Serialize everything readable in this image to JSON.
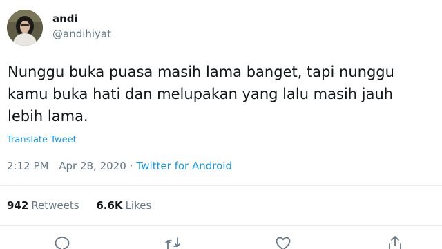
{
  "author": {
    "name": "andi",
    "handle": "@andihiyat"
  },
  "tweet": {
    "text": "Nunggu buka puasa masih lama banget, tapi nunggu kamu buka hati dan melupakan yang lalu masih jauh lebih lama.",
    "translate_label": "Translate Tweet",
    "time": "2:12 PM",
    "separator": "·",
    "date": "Apr 28, 2020",
    "source": "Twitter for Android"
  },
  "stats": {
    "retweets_count": "942",
    "retweets_label": "Retweets",
    "likes_count": "6.6K",
    "likes_label": "Likes"
  },
  "actions": {
    "icons": [
      "reply-icon",
      "retweet-icon",
      "like-icon",
      "share-icon"
    ]
  },
  "colors": {
    "link": "#1b95e0",
    "secondary_text": "#657786",
    "divider": "#e6ecf0"
  }
}
